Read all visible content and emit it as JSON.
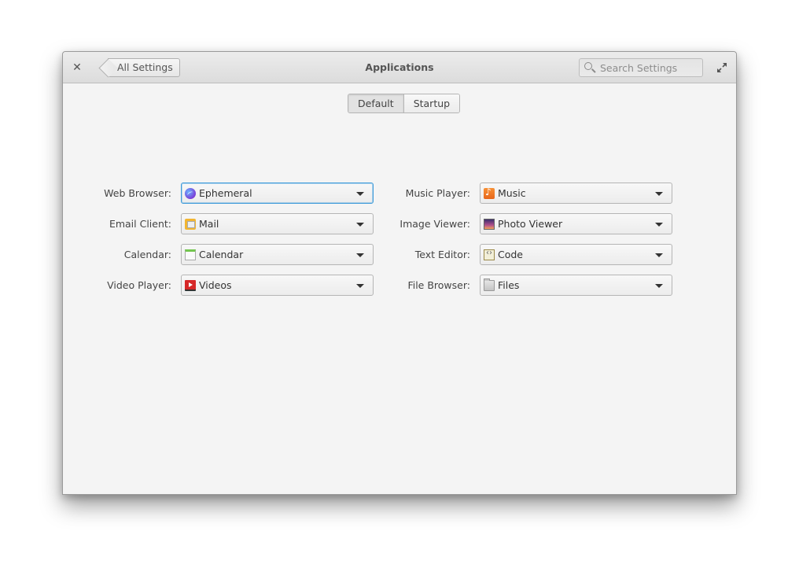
{
  "window": {
    "title": "Applications",
    "back_button_label": "All Settings",
    "search": {
      "placeholder": "Search Settings",
      "value": ""
    },
    "icons": {
      "close": "close-icon",
      "maximize": "maximize-icon",
      "search": "search-icon"
    }
  },
  "mode_switch": {
    "tabs": [
      {
        "label": "Default",
        "active": true
      },
      {
        "label": "Startup",
        "active": false
      }
    ]
  },
  "defaults": {
    "left": [
      {
        "label": "Web Browser:",
        "value": "Ephemeral",
        "icon": "ephemeral-icon",
        "focused": true
      },
      {
        "label": "Email Client:",
        "value": "Mail",
        "icon": "mail-icon"
      },
      {
        "label": "Calendar:",
        "value": "Calendar",
        "icon": "calendar-icon"
      },
      {
        "label": "Video Player:",
        "value": "Videos",
        "icon": "videos-icon"
      }
    ],
    "right": [
      {
        "label": "Music Player:",
        "value": "Music",
        "icon": "music-icon"
      },
      {
        "label": "Image Viewer:",
        "value": "Photo Viewer",
        "icon": "photo-viewer-icon"
      },
      {
        "label": "Text Editor:",
        "value": "Code",
        "icon": "code-icon"
      },
      {
        "label": "File Browser:",
        "value": "Files",
        "icon": "files-icon"
      }
    ]
  },
  "colors": {
    "focus_accent": "#3d9bda",
    "window_bg": "#f4f4f4"
  }
}
